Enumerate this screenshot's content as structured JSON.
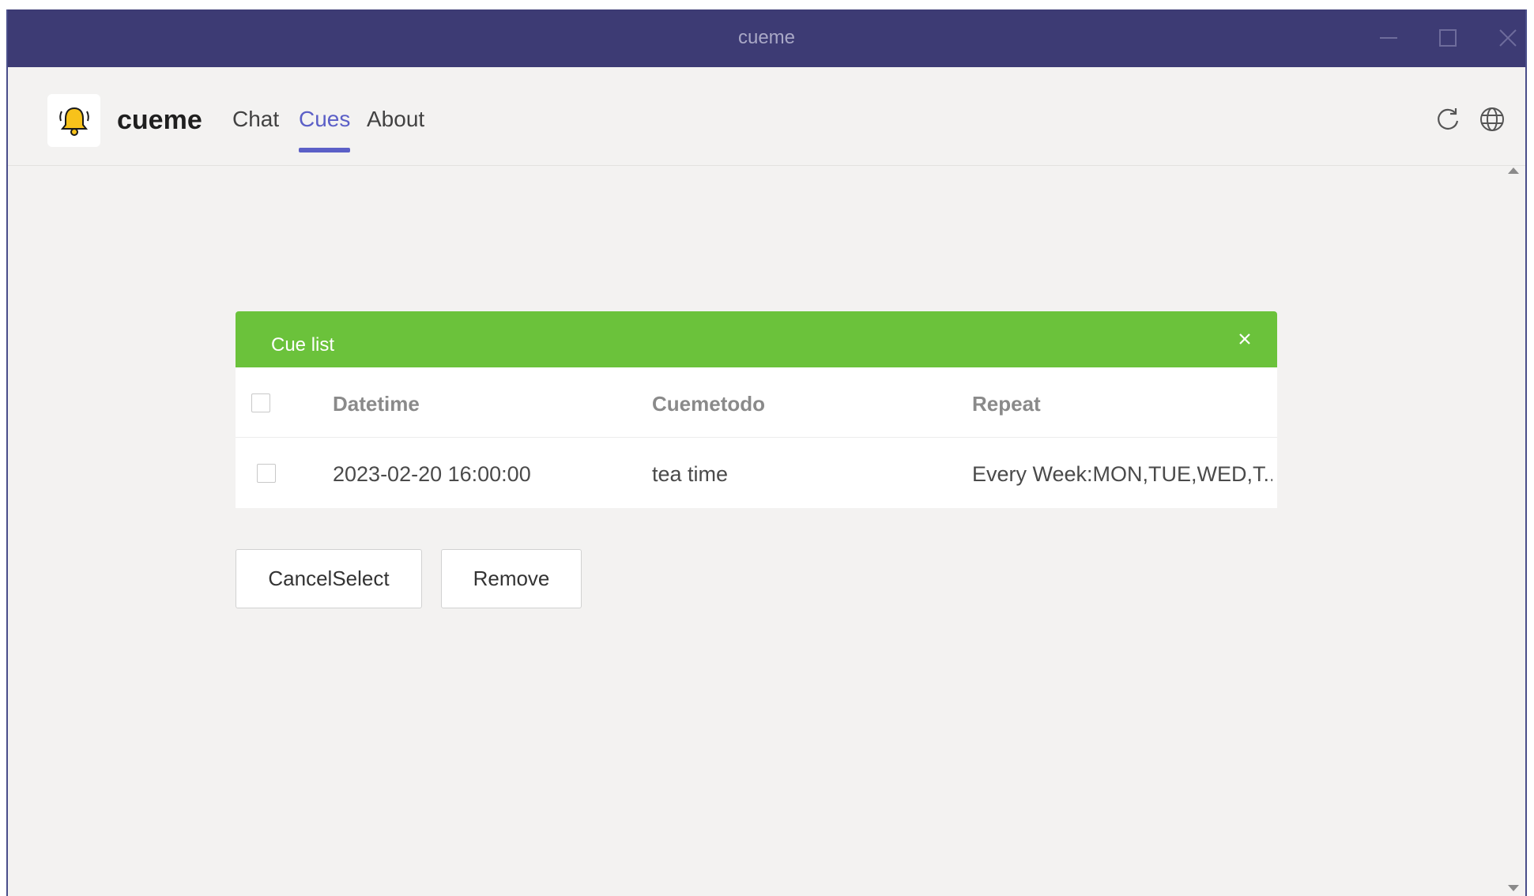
{
  "window": {
    "title": "cueme"
  },
  "app": {
    "brand": "cueme",
    "logo_icon": "bell-icon",
    "accent_color": "#5b5fc7"
  },
  "nav": {
    "tabs": [
      {
        "label": "Chat",
        "active": false
      },
      {
        "label": "Cues",
        "active": true
      },
      {
        "label": "About",
        "active": false
      }
    ],
    "icons": [
      "refresh-icon",
      "globe-icon"
    ]
  },
  "cue_list": {
    "title": "Cue list",
    "header_color": "#6bc23b",
    "columns": [
      "Datetime",
      "Cuemetodo",
      "Repeat"
    ],
    "rows": [
      {
        "datetime": "2023-02-20 16:00:00",
        "todo": "tea time",
        "repeat": "Every Week:MON,TUE,WED,T..."
      }
    ]
  },
  "actions": {
    "cancel_select": "CancelSelect",
    "remove": "Remove"
  }
}
